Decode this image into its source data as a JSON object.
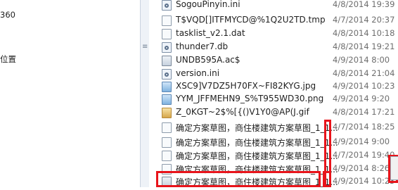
{
  "nav_pane": {
    "items": [
      "360",
      "位置"
    ]
  },
  "files": [
    {
      "name": "SogouPinyin.ini",
      "date": "4/8/2014 19:39",
      "icon": "ini"
    },
    {
      "name": "T$VQD[]ITFMYCD@%1Q2U2TD.tmp",
      "date": "4/7/2014 20:37",
      "icon": "doc"
    },
    {
      "name": "tasklist_v2.1.dat",
      "date": "4/8/2014 10:18",
      "icon": "doc"
    },
    {
      "name": "thunder7.db",
      "date": "4/8/2014 19:21",
      "icon": "ini"
    },
    {
      "name": "UNDB595A.ac$",
      "date": "4/9/2014 8:00",
      "icon": "exe"
    },
    {
      "name": "version.ini",
      "date": "4/8/2014 21:04",
      "icon": "ini"
    },
    {
      "name": "XSC9]V7DZ5H70FX~FI82KYG.jpg",
      "date": "4/9/2014 10:23",
      "icon": "img"
    },
    {
      "name": "YYM_JFFMEHN9_S%T955WD30.png",
      "date": "4/9/2014 9:20",
      "icon": "img"
    },
    {
      "name": "Z_0KGT~2$%[{()V1Y0@AP(J.gif",
      "date": "4/8/2014 17:21",
      "icon": "gif"
    },
    {
      "name": "确定方案草图，商住楼建筑方案草图_1_1...",
      "date": "4/7/2014 18:25",
      "icon": "doc"
    },
    {
      "name": "确定方案草图，商住楼建筑方案草图_1_1...",
      "date": "4/9/2014 9:00",
      "icon": "doc"
    },
    {
      "name": "确定方案草图，商住楼建筑方案草图_1_1...",
      "date": "4/7/2014 19:40",
      "icon": "doc"
    },
    {
      "name": "确定方案草图，商住楼建筑方案草图_1_1...",
      "date": "4/9/2014 8:26",
      "icon": "doc"
    },
    {
      "name": "确定方案草图，商住楼建筑方案草图_1_1...",
      "date": "4/9/2014 10:23",
      "icon": "exe"
    }
  ],
  "colors": {
    "highlight_box": "#e8141b",
    "date_text": "#6d6d6d"
  }
}
